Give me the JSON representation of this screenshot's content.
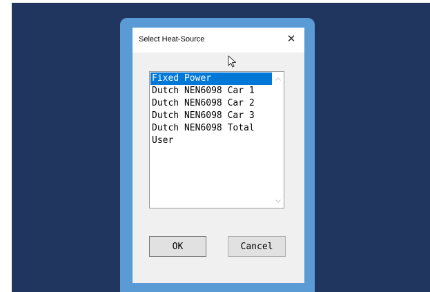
{
  "dialog": {
    "title": "Select Heat-Source",
    "close_glyph": "✕",
    "close_icon": "close-icon",
    "cursor_icon": "mouse-pointer-icon"
  },
  "listbox": {
    "selected_index": 0,
    "items": [
      {
        "label": "Fixed Power"
      },
      {
        "label": "Dutch NEN6098 Car 1"
      },
      {
        "label": "Dutch NEN6098 Car 2"
      },
      {
        "label": "Dutch NEN6098 Car 3"
      },
      {
        "label": "Dutch NEN6098 Total"
      },
      {
        "label": "User"
      }
    ],
    "scroll_up_icon": "scroll-up-arrow-icon",
    "scroll_down_icon": "scroll-down-arrow-icon"
  },
  "buttons": {
    "ok_label": "OK",
    "cancel_label": "Cancel"
  },
  "colors": {
    "backdrop": "#21365f",
    "frame": "#5b9bd5",
    "selection": "#0078d7"
  }
}
